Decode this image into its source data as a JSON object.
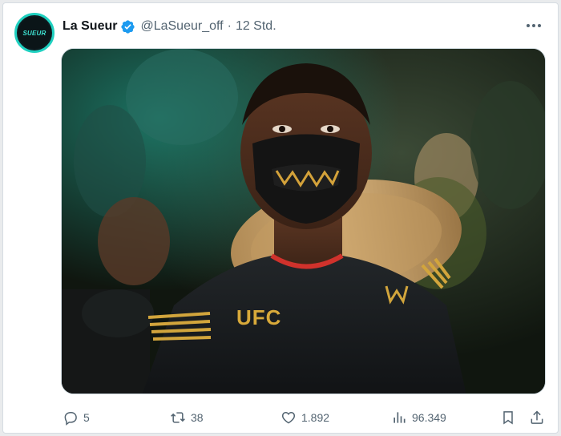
{
  "tweet": {
    "author_name": "La Sueur",
    "author_handle": "@LaSueur_off",
    "separator": "·",
    "time": "12 Std.",
    "avatar_text": "SUEUR",
    "verified": true,
    "media": {
      "shirt_logo_text": "UFC"
    },
    "stats": {
      "replies": "5",
      "retweets": "38",
      "likes": "1.892",
      "views": "96.349"
    }
  },
  "colors": {
    "verified_blue": "#1d9bf0",
    "muted_text": "#536471",
    "avatar_accent": "#1fd0c0"
  },
  "icons": [
    "reply-icon",
    "retweet-icon",
    "like-icon",
    "views-icon",
    "bookmark-icon",
    "share-icon",
    "more-icon",
    "verified-icon"
  ]
}
